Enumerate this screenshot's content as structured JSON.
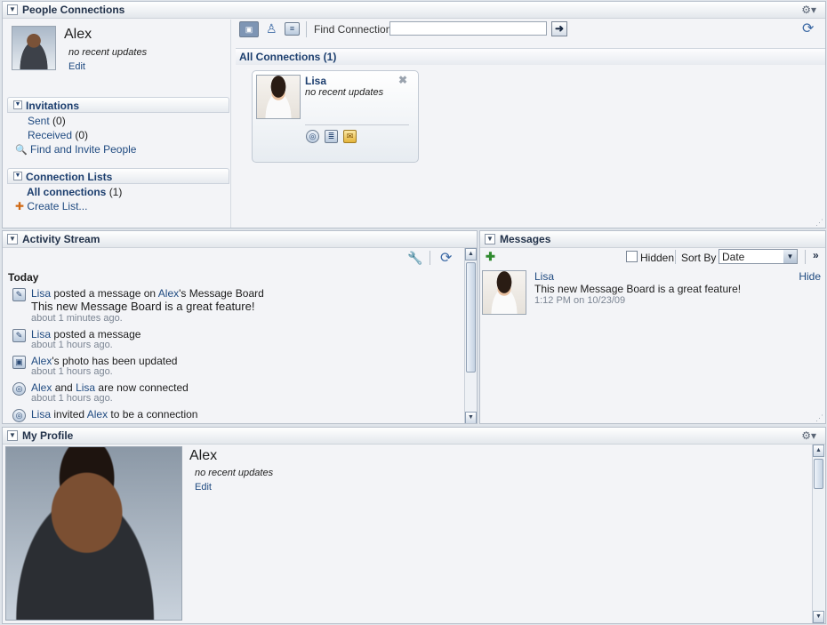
{
  "people": {
    "title": "People Connections",
    "user": {
      "name": "Alex",
      "status": "no recent updates",
      "edit": "Edit"
    },
    "invitations": {
      "title": "Invitations",
      "sent_label": "Sent",
      "sent_count": "(0)",
      "received_label": "Received",
      "received_count": "(0)",
      "find_invite": "Find and Invite People"
    },
    "lists": {
      "title": "Connection Lists",
      "all_label": "All connections",
      "all_count": "(1)",
      "create": "Create List..."
    },
    "find_label": "Find Connection",
    "find_placeholder": "",
    "all_connections": "All Connections (1)",
    "card": {
      "name": "Lisa",
      "status": "no recent updates"
    }
  },
  "activity": {
    "title": "Activity Stream",
    "today": "Today",
    "items": [
      {
        "a": "Lisa",
        "t1": "posted a message on",
        "b": "Alex",
        "t2": "'s Message Board",
        "msg": "This new Message Board is a great feature!",
        "time": "about 1 minutes ago."
      },
      {
        "a": "Lisa",
        "t1": "posted a message",
        "time": "about 1 hours ago."
      },
      {
        "a": "Alex",
        "t1": "'s photo has been updated",
        "time": "about 1 hours ago."
      },
      {
        "a": "Alex",
        "t1": "and",
        "b": "Lisa",
        "t2": "are now connected",
        "time": "about 1 hours ago."
      },
      {
        "a": "Lisa",
        "t1": "invited",
        "b": "Alex",
        "t2": "to be a connection"
      }
    ]
  },
  "messages": {
    "title": "Messages",
    "hidden": "Hidden",
    "sort_by": "Sort By",
    "sort_value": "Date",
    "item": {
      "name": "Lisa",
      "text": "This new Message Board is a great feature!",
      "time": "1:12 PM on 10/23/09",
      "hide": "Hide"
    }
  },
  "profile": {
    "title": "My Profile",
    "name": "Alex",
    "status": "no recent updates",
    "edit": "Edit"
  }
}
